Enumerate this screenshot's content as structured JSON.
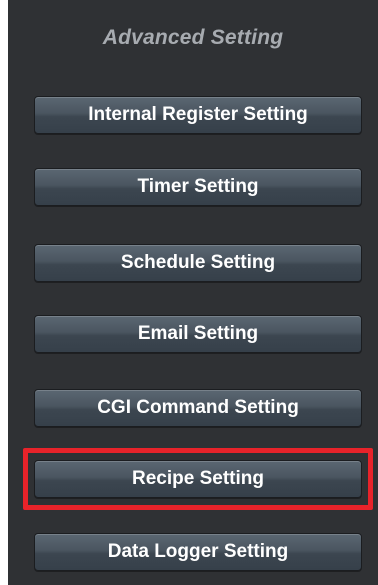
{
  "panel": {
    "title": "Advanced Setting",
    "buttons": [
      {
        "label": "Internal Register Setting"
      },
      {
        "label": "Timer Setting"
      },
      {
        "label": "Schedule Setting"
      },
      {
        "label": "Email Setting"
      },
      {
        "label": "CGI Command Setting"
      },
      {
        "label": "Recipe Setting"
      },
      {
        "label": "Data Logger Setting"
      }
    ],
    "highlight_color": "#e8232a"
  }
}
